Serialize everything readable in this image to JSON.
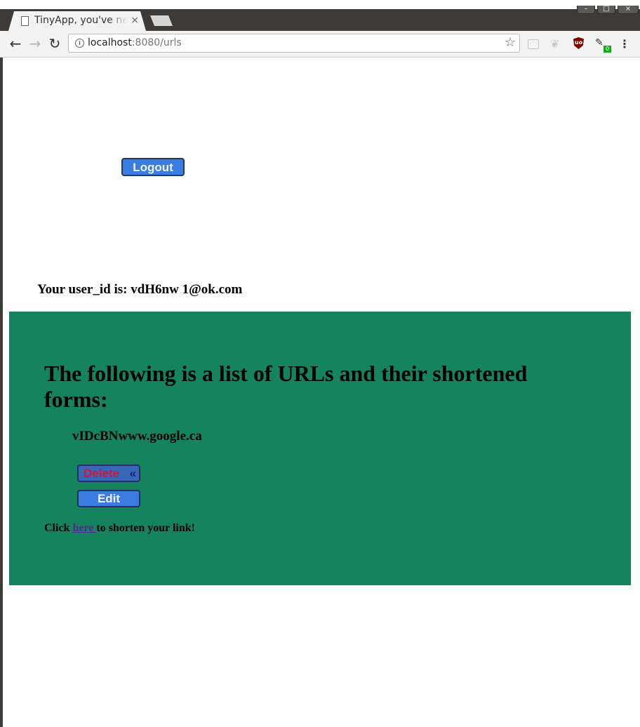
{
  "browser": {
    "tab_title": "TinyApp, you've never",
    "tab_close": "×",
    "url_host": "localhost",
    "url_path": ":8080/urls",
    "window_controls": [
      "–",
      "□",
      "×"
    ],
    "extension_badge": "0",
    "shield_label": "uo"
  },
  "page": {
    "logout_label": "Logout",
    "user_id_line": "Your user_id is: vdH6nw 1@ok.com",
    "heading": "The following is a list of URLs and their shortened forms:",
    "url_entry": "vIDcBNwww.google.ca",
    "delete_label": "Delete",
    "delete_chevron": "«",
    "edit_label": "Edit",
    "shorten_prefix": "Click ",
    "shorten_link": "here ",
    "shorten_suffix": "to shorten your link!"
  },
  "colors": {
    "panel_bg": "#14835e",
    "button_bg": "#3a7ce0",
    "delete_text": "#d5143e"
  }
}
